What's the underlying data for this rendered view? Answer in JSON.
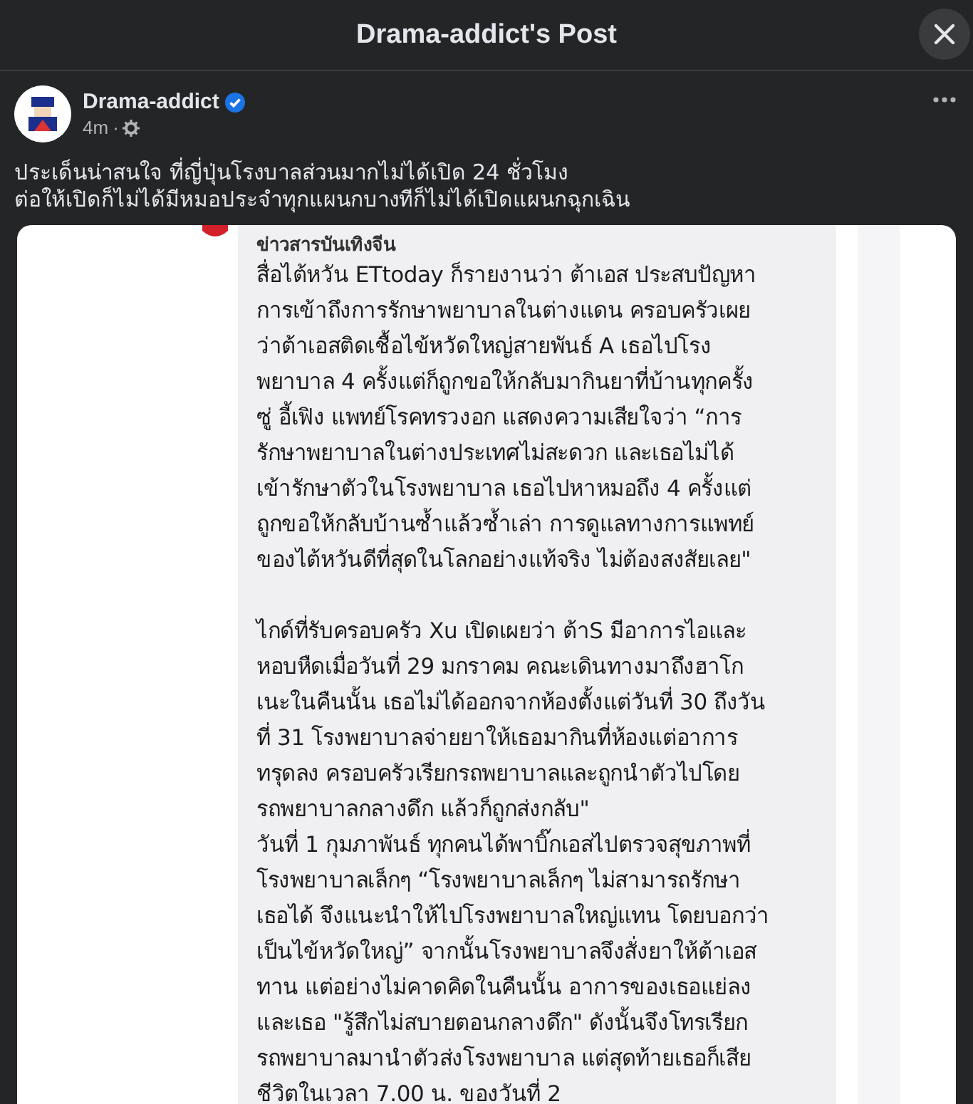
{
  "header": {
    "title": "Drama-addict's Post"
  },
  "post": {
    "author": "Drama-addict",
    "verified": true,
    "time": "4m",
    "separator": "·",
    "text_lines": [
      "ประเด็นน่าสนใจ ที่ญี่ปุ่นโรงบาลส่วนมากไม่ได้เปิด 24 ชั่วโมง",
      "ต่อให้เปิดก็ไม่ได้มีหมอประจำทุกแผนกบางทีก็ไม่ได้เปิดแผนกฉุกเฉิน"
    ],
    "shared_image": {
      "caption": "ข่าวสารบันเทิงจีน",
      "paragraphs": [
        {
          "lines": [
            "สื่อไต้หวัน ETtoday ก็รายงานว่า ต้าเอส ประสบปัญหา",
            "การเข้าถึงการรักษาพยาบาลในต่างแดน ครอบครัวเผย",
            "ว่าต้าเอสติดเชื้อไข้หวัดใหญ่สายพันธ์ A เธอไปโรง",
            "พยาบาล 4 ครั้งแต่ก็ถูกขอให้กลับมากินยาที่บ้านทุกครั้ง",
            "ซู่ อี้เฟิง แพทย์โรคทรวงอก แสดงความเสียใจว่า “การ",
            "รักษาพยาบาลในต่างประเทศไม่สะดวก และเธอไม่ได้",
            "เข้ารักษาตัวในโรงพยาบาล เธอไปหาหมอถึง 4 ครั้งแต่",
            "ถูกขอให้กลับบ้านซ้ำแล้วซ้ำเล่า การดูแลทางการแพทย์",
            "ของไต้หวันดีที่สุดในโลกอย่างแท้จริง ไม่ต้องสงสัยเลย\""
          ]
        },
        {
          "lines": [
            "ไกด์ที่รับครอบครัว Xu เปิดเผยว่า ต้าS มีอาการไอและ",
            "หอบหืดเมื่อวันที่ 29 มกราคม คณะเดินทางมาถึงฮาโก",
            "เนะในคืนนั้น เธอไม่ได้ออกจากห้องตั้งแต่วันที่ 30 ถึงวัน",
            "ที่ 31 โรงพยาบาลจ่ายยาให้เธอมากินที่ห้องแต่อาการ",
            "ทรุดลง ครอบครัวเรียกรถพยาบาลและถูกนำตัวไปโดย",
            "รถพยาบาลกลางดึก แล้วก็ถูกส่งกลับ\"",
            "วันที่ 1 กุมภาพันธ์ ทุกคนได้พาบิ๊กเอสไปตรวจสุขภาพที่",
            "โรงพยาบาลเล็กๆ “โรงพยาบาลเล็กๆ ไม่สามารถรักษา",
            "เธอได้ จึงแนะนำให้ไปโรงพยาบาลใหญ่แทน โดยบอกว่า",
            "เป็นไข้หวัดใหญ่” จากนั้นโรงพยาบาลจึงสั่งยาให้ต้าเอส",
            "ทาน แต่อย่างไม่คาดคิดในคืนนั้น อาการของเธอแย่ลง",
            "และเธอ \"รู้สึกไม่สบายตอนกลางดึก\" ดังนั้นจึงโทรเรียก",
            "รถพยาบาลมานำตัวส่งโรงพยาบาล  แต่สุดท้ายเธอก็เสีย",
            "ชีวิตในเวลา 7.00 น. ของวันที่ 2"
          ]
        }
      ]
    }
  }
}
